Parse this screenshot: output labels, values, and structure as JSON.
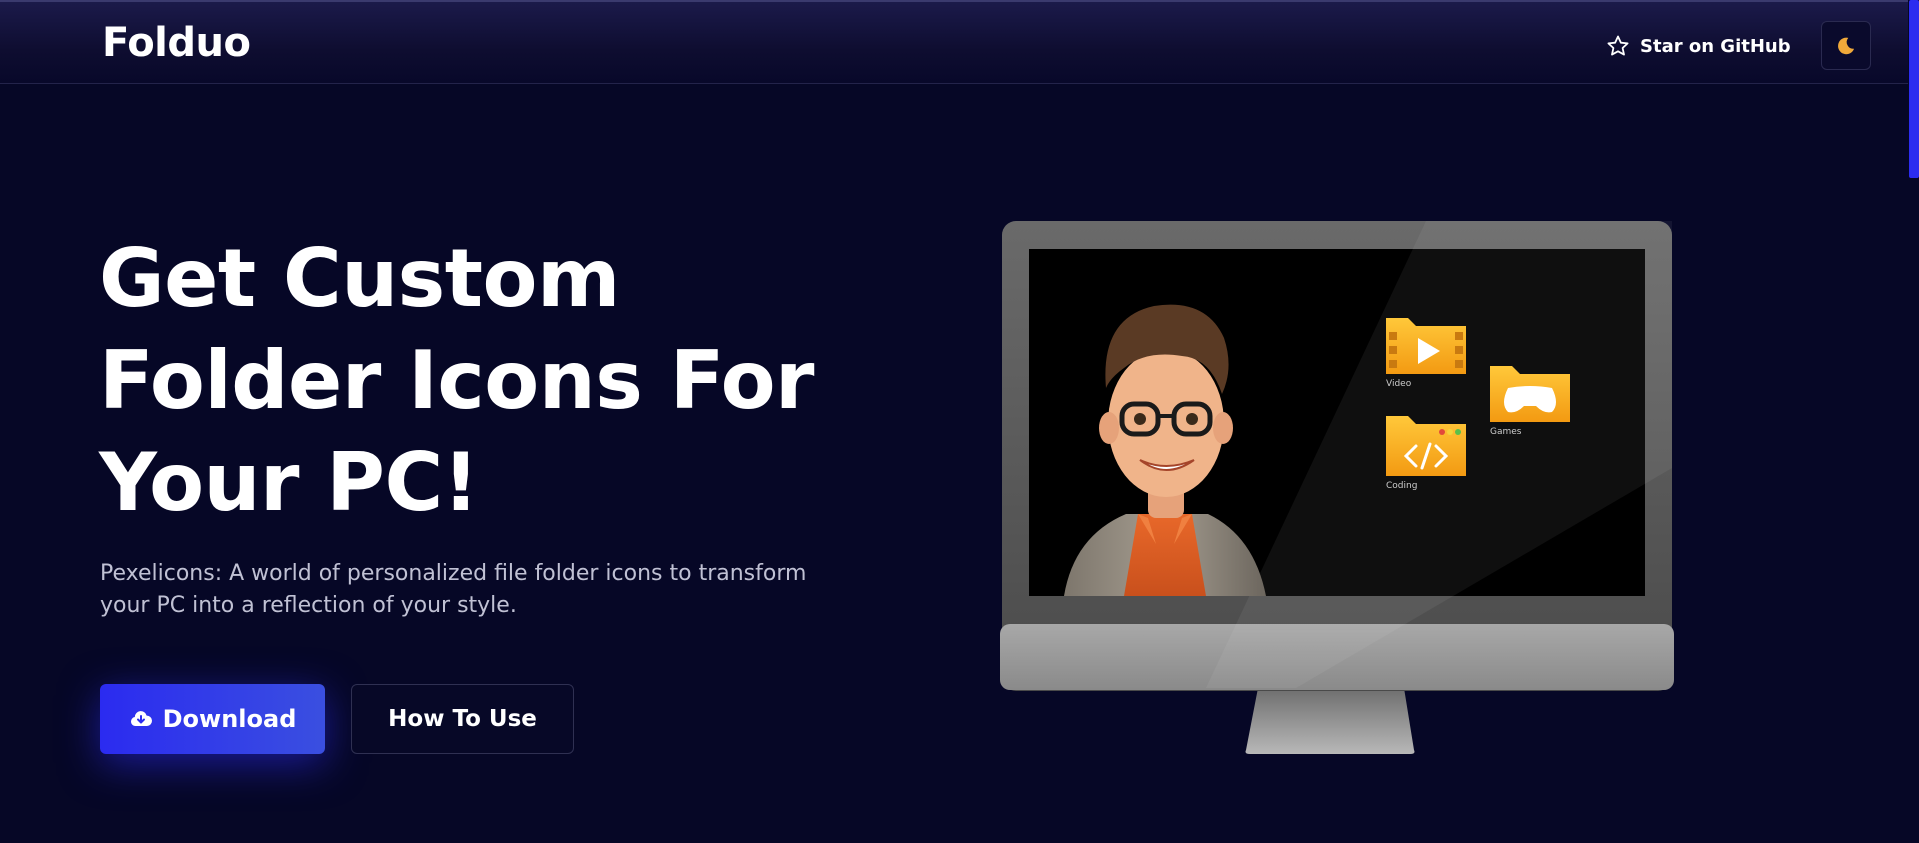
{
  "header": {
    "brand": "Folduo",
    "github_label": "Star on GitHub",
    "icons": {
      "github": "star-icon",
      "theme": "moon-icon"
    }
  },
  "hero": {
    "title_lines": [
      "Get Custom",
      "Folder Icons For",
      "Your PC!"
    ],
    "subtitle_lines": [
      "Pexelicons: A world of personalized file folder icons to transform",
      "your PC into a reflection of your style."
    ],
    "download_label": "Download",
    "download_icon": "cloud-download-icon",
    "howto_label": "How To Use"
  },
  "illustration": {
    "folders": [
      {
        "label": "Video",
        "icon": "play-icon"
      },
      {
        "label": "Games",
        "icon": "gamepad-icon"
      },
      {
        "label": "Coding",
        "icon": "code-icon"
      }
    ]
  },
  "colors": {
    "background": "#060726",
    "accent": "#2b2bf0",
    "folder": "#f5a81a",
    "moon": "#f0a93a"
  }
}
